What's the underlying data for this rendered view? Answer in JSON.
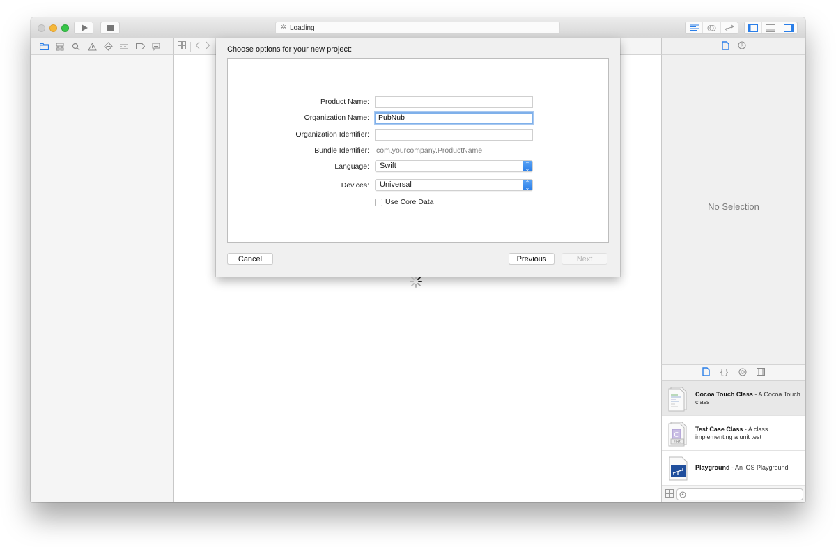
{
  "window": {
    "activity": {
      "status": "Loading"
    },
    "toolbar": {
      "run_label": "Run",
      "stop_label": "Stop"
    }
  },
  "navigator": {
    "tabs": [
      {
        "name": "project-navigator",
        "icon": "folder-icon",
        "active": true
      },
      {
        "name": "symbol-navigator",
        "icon": "hierarchy-icon"
      },
      {
        "name": "find-navigator",
        "icon": "search-icon"
      },
      {
        "name": "issue-navigator",
        "icon": "warning-icon"
      },
      {
        "name": "test-navigator",
        "icon": "diamond-icon"
      },
      {
        "name": "debug-navigator",
        "icon": "gauge-icon"
      },
      {
        "name": "breakpoint-navigator",
        "icon": "breakpoint-icon"
      },
      {
        "name": "report-navigator",
        "icon": "speech-bubble-icon"
      }
    ]
  },
  "sheet": {
    "title": "Choose options for your new project:",
    "fields": {
      "product_name": {
        "label": "Product Name:",
        "value": ""
      },
      "organization_name": {
        "label": "Organization Name:",
        "value": "PubNub"
      },
      "organization_identifier": {
        "label": "Organization Identifier:",
        "value": ""
      },
      "bundle_identifier": {
        "label": "Bundle Identifier:",
        "value": "com.yourcompany.ProductName"
      },
      "language": {
        "label": "Language:",
        "value": "Swift"
      },
      "devices": {
        "label": "Devices:",
        "value": "Universal"
      },
      "use_core_data": {
        "label": "Use Core Data",
        "checked": false
      }
    },
    "buttons": {
      "cancel": "Cancel",
      "previous": "Previous",
      "next": "Next"
    }
  },
  "inspector": {
    "empty_text": "No Selection"
  },
  "library": {
    "items": [
      {
        "title": "Cocoa Touch Class",
        "description": " - A Cocoa Touch class",
        "selected": true
      },
      {
        "title": "Test Case Class",
        "description": " - A class implementing a unit test",
        "selected": false
      },
      {
        "title": "Playground",
        "description": " - An iOS Playground",
        "selected": false
      }
    ],
    "filter": {
      "placeholder": ""
    }
  },
  "colors": {
    "accent": "#2a7ee8",
    "close": "#d0d0d0",
    "minimize": "#f5b83a",
    "zoom": "#37c548"
  }
}
